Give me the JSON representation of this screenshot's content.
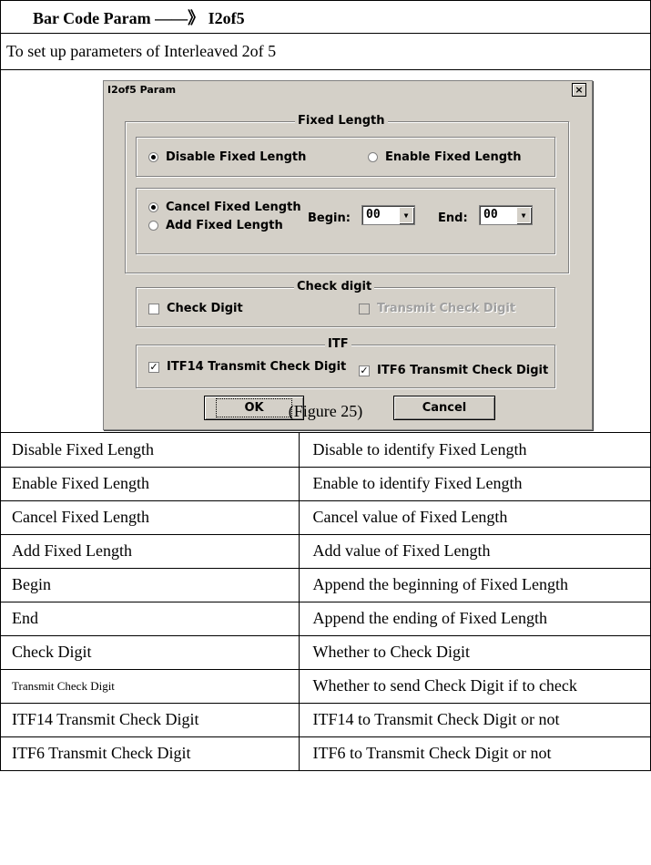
{
  "header": {
    "title": "Bar Code Param ——》 I2of5"
  },
  "intro": "To set up parameters of Interleaved 2of 5",
  "dialog": {
    "title": "I2of5 Param",
    "close_glyph": "×",
    "fixed_length": {
      "legend": "Fixed Length",
      "disable_label": "Disable Fixed Length",
      "enable_label": "Enable  Fixed Length",
      "cancel_label": "Cancel Fixed Length",
      "add_label": "Add  Fixed Length",
      "begin_label": "Begin:",
      "begin_value": "00",
      "end_label": "End:",
      "end_value": "00"
    },
    "check_digit": {
      "legend": "Check digit",
      "check_label": "Check Digit",
      "transmit_label": "Transmit Check Digit"
    },
    "itf": {
      "legend": "ITF",
      "itf14_label": "ITF14 Transmit Check Digit",
      "itf6_label": "ITF6 Transmit Check Digit"
    },
    "ok_label": "OK",
    "cancel_label": "Cancel",
    "arrow_glyph": "▼",
    "check_glyph": "✓"
  },
  "caption": "(Figure 25)",
  "definitions": [
    {
      "term": "Disable Fixed Length",
      "desc": "Disable to identify Fixed Length"
    },
    {
      "term": "Enable Fixed Length",
      "desc": "Enable to identify Fixed Length"
    },
    {
      "term": "Cancel Fixed Length",
      "desc": "Cancel value of Fixed Length"
    },
    {
      "term": "Add Fixed Length",
      "desc": "Add value of Fixed Length"
    },
    {
      "term": "Begin",
      "desc": "Append the beginning of Fixed Length"
    },
    {
      "term": "End",
      "desc": "Append the ending of Fixed Length"
    },
    {
      "term": "Check Digit",
      "desc": "Whether to Check Digit"
    },
    {
      "term": "Transmit Check Digit",
      "desc": "Whether to send Check Digit if to check"
    },
    {
      "term": "ITF14 Transmit Check Digit",
      "desc": "ITF14 to Transmit Check Digit or not"
    },
    {
      "term": "ITF6 Transmit Check Digit",
      "desc": "ITF6 to Transmit Check Digit or not"
    }
  ]
}
